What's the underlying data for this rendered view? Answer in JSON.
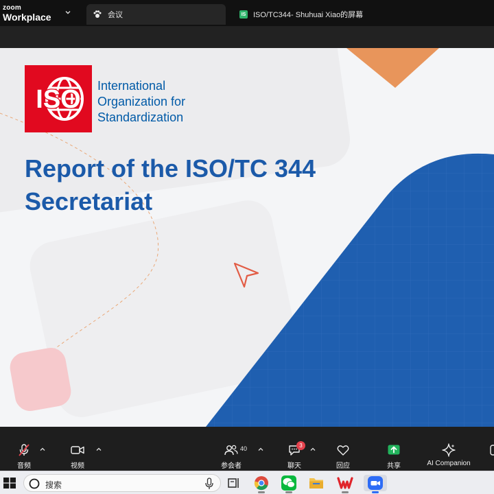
{
  "app": {
    "brand_top": "zoom",
    "brand_bottom": "Workplace"
  },
  "tabs": [
    {
      "label": "会议",
      "icon": "paw-icon"
    },
    {
      "label": "ISO/TC344- Shuhuai Xiao的屏幕",
      "badge": "IS",
      "icon": "screen-share-badge"
    }
  ],
  "slide": {
    "org_lines": [
      "International",
      "Organization for",
      "Standardization"
    ],
    "logo_text": "ISO",
    "title_lines": [
      "Report of the ISO/TC 344",
      "Secretariat"
    ],
    "colors": {
      "iso_red": "#e1091f",
      "title_blue": "#1b5aa9",
      "shape_blue": "#1f5fb0",
      "accent_orange": "#e8955b",
      "accent_pink": "#f6c9cc"
    }
  },
  "toolbar": {
    "audio_label": "音频",
    "video_label": "视频",
    "participants_label": "参会者",
    "participants_count": "40",
    "chat_label": "聊天",
    "chat_badge": "3",
    "reactions_label": "回应",
    "share_label": "共享",
    "ai_label": "AI Companion"
  },
  "taskbar": {
    "search_placeholder": "搜索",
    "apps": [
      "task-view-icon",
      "chrome-icon",
      "wechat-icon",
      "file-explorer-icon",
      "wps-icon",
      "zoom-icon"
    ]
  }
}
